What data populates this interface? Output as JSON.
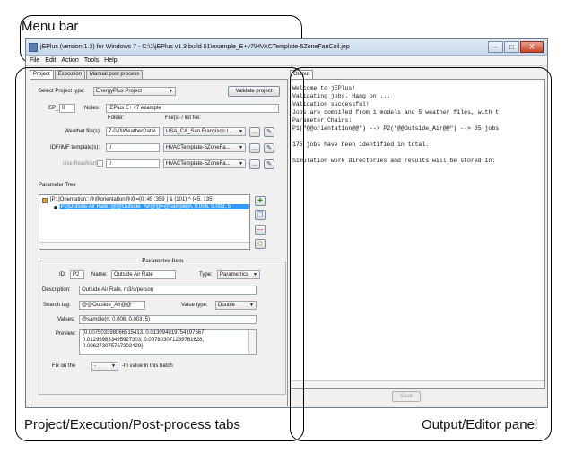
{
  "annotations": {
    "menu_bar": "Menu bar",
    "left_tabs": "Project/Execution/Post-process tabs",
    "output_panel": "Output/Editor panel"
  },
  "window": {
    "title": "jEPlus (version 1.3) for Windows 7 - C:\\1\\jEPlus v1.3 build 01\\example_E+v7\\HVACTemplate-5ZoneFanCoil.jep",
    "controls": [
      "–",
      "□",
      "X"
    ]
  },
  "menu": [
    "File",
    "Edit",
    "Action",
    "Tools",
    "Help"
  ],
  "tabs": [
    "Project",
    "Execution",
    "Manual post process"
  ],
  "project": {
    "type_label": "Select Project type:",
    "type_value": "EnergyPlus Project",
    "validate_button": "Validate project",
    "ep_label": "EP_",
    "ep_value": "0",
    "notes_label": "Notes:",
    "notes_value": "jEPlus E+ v7 example",
    "folder_header": "Folder:",
    "files_header": "File(s) / list file:",
    "weather_label": "Weather file(s):",
    "weather_folder": "7-0-0\\WeatherData\\",
    "weather_file": "USA_CA_San.Francisco.I...",
    "idf_label": "IDF/IMF template(s):",
    "idf_folder": "./",
    "idf_file": "HVACTemplate-5ZoneFa...",
    "rvx_label": "Use ReadVars",
    "rvx_folder": "./",
    "rvx_file": "HVACTemplate-5ZoneFa...",
    "browse": "...",
    "param_tree_label": "Parameter Tree",
    "tree": [
      "[P1]Orientation::@@orientation@@=[0 :45 :359 ] & {101} ^ {45, 135}",
      "[P2]Outside Air Rate::@@Outside_Air@@=@sample(n, 0.006, 0.003, 5"
    ]
  },
  "param_item": {
    "legend": "Parameter item",
    "id_label": "ID:",
    "id_value": "P2",
    "name_label": "Name:",
    "name_value": "Outside Air Rate",
    "type_label": "Type:",
    "type_value": "Parametrics",
    "desc_label": "Description:",
    "desc_value": "Outside Air Rate, m3/s/person",
    "tag_label": "Search tag:",
    "tag_value": "@@Outside_Air@@",
    "vtype_label": "Value type:",
    "vtype_value": "Double",
    "values_label": "Values:",
    "values_value": "@sample(n, 0.008, 0.003, 5)",
    "preview_label": "Preview:",
    "preview_lines": [
      "{0.007503398066515413, 0.013094919754197567,",
      "0.012969833495927303, 0.007803071239761628,",
      "0.006273075767303429}"
    ],
    "fix_label": "Fix on the",
    "fix_value": "-",
    "fix_suffix": "-th value in this batch"
  },
  "output": {
    "tab": "Output",
    "lines": [
      "Welcome to jEPlus!",
      "Validating jobs. Hang on ...",
      "Validation successful!",
      "Jobs are compiled from 1 models and 5 weather files, with t",
      "Parameter Chains:",
      "P1(\"@@orientation@@\") --> P2(\"@@Outside_Air@@\") --> 35 jobs",
      "",
      "175 jobs have been identified in total.",
      "",
      "Simulation work directories and results will be stored in:"
    ],
    "save_button": "Save"
  }
}
